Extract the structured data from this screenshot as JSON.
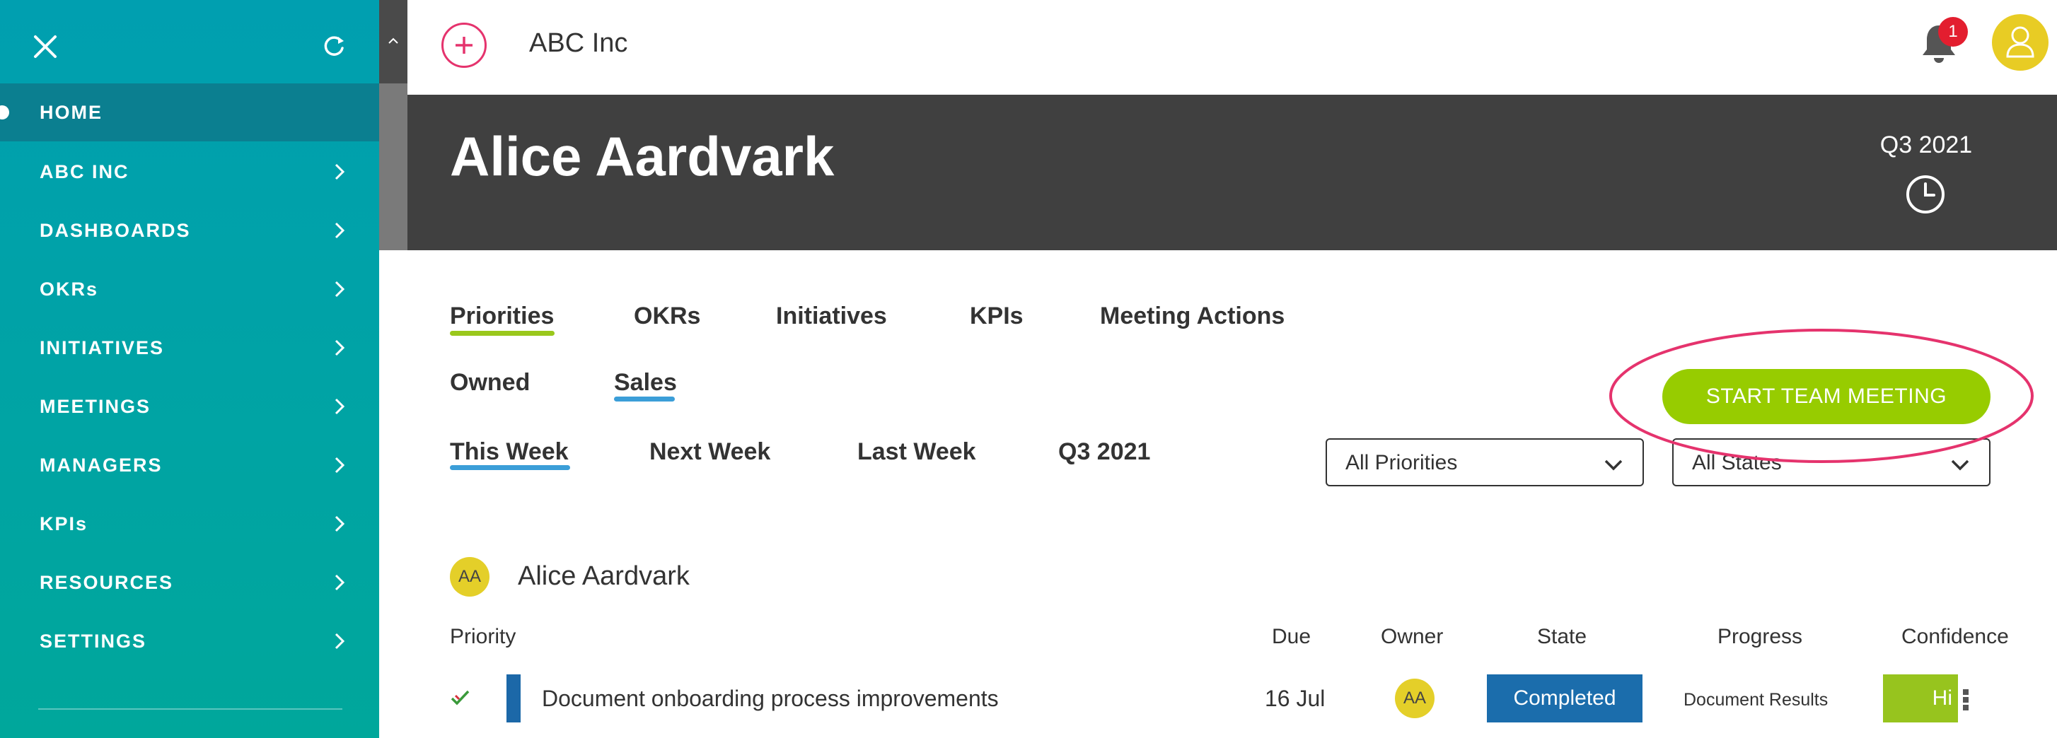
{
  "sidebar": {
    "items": [
      {
        "label": "HOME",
        "active": true
      },
      {
        "label": "ABC INC"
      },
      {
        "label": "DASHBOARDS"
      },
      {
        "label": "OKRs"
      },
      {
        "label": "INITIATIVES"
      },
      {
        "label": "MEETINGS"
      },
      {
        "label": "MANAGERS"
      },
      {
        "label": "KPIs"
      },
      {
        "label": "RESOURCES"
      },
      {
        "label": "SETTINGS"
      }
    ],
    "icons": {
      "close": "close-icon",
      "refresh": "refresh-icon",
      "chevron": "chevron-right-icon"
    }
  },
  "topbar": {
    "company": "ABC Inc",
    "notification_count": "1"
  },
  "header": {
    "title": "Alice Aardvark",
    "period": "Q3 2021"
  },
  "tabs": {
    "main": [
      "Priorities",
      "OKRs",
      "Initiatives",
      "KPIs",
      "Meeting Actions"
    ],
    "scope": [
      "Owned",
      "Sales"
    ],
    "time": [
      "This Week",
      "Next Week",
      "Last Week",
      "Q3 2021"
    ]
  },
  "actions": {
    "start_meeting": "START TEAM MEETING"
  },
  "filters": {
    "priorities": "All Priorities",
    "states": "All States"
  },
  "group": {
    "initials": "AA",
    "name": "Alice Aardvark"
  },
  "columns": {
    "priority": "Priority",
    "due": "Due",
    "owner": "Owner",
    "state": "State",
    "progress": "Progress",
    "confidence": "Confidence"
  },
  "rows": [
    {
      "title": "Document onboarding process improvements",
      "due": "16 Jul",
      "owner": "AA",
      "state": "Completed",
      "progress": "Document Results",
      "confidence": "Hi"
    }
  ],
  "colors": {
    "accent_green": "#97cc00",
    "accent_pink": "#e5336d",
    "state_blue": "#1b6dac",
    "sidebar_teal": "#00a3a8"
  }
}
